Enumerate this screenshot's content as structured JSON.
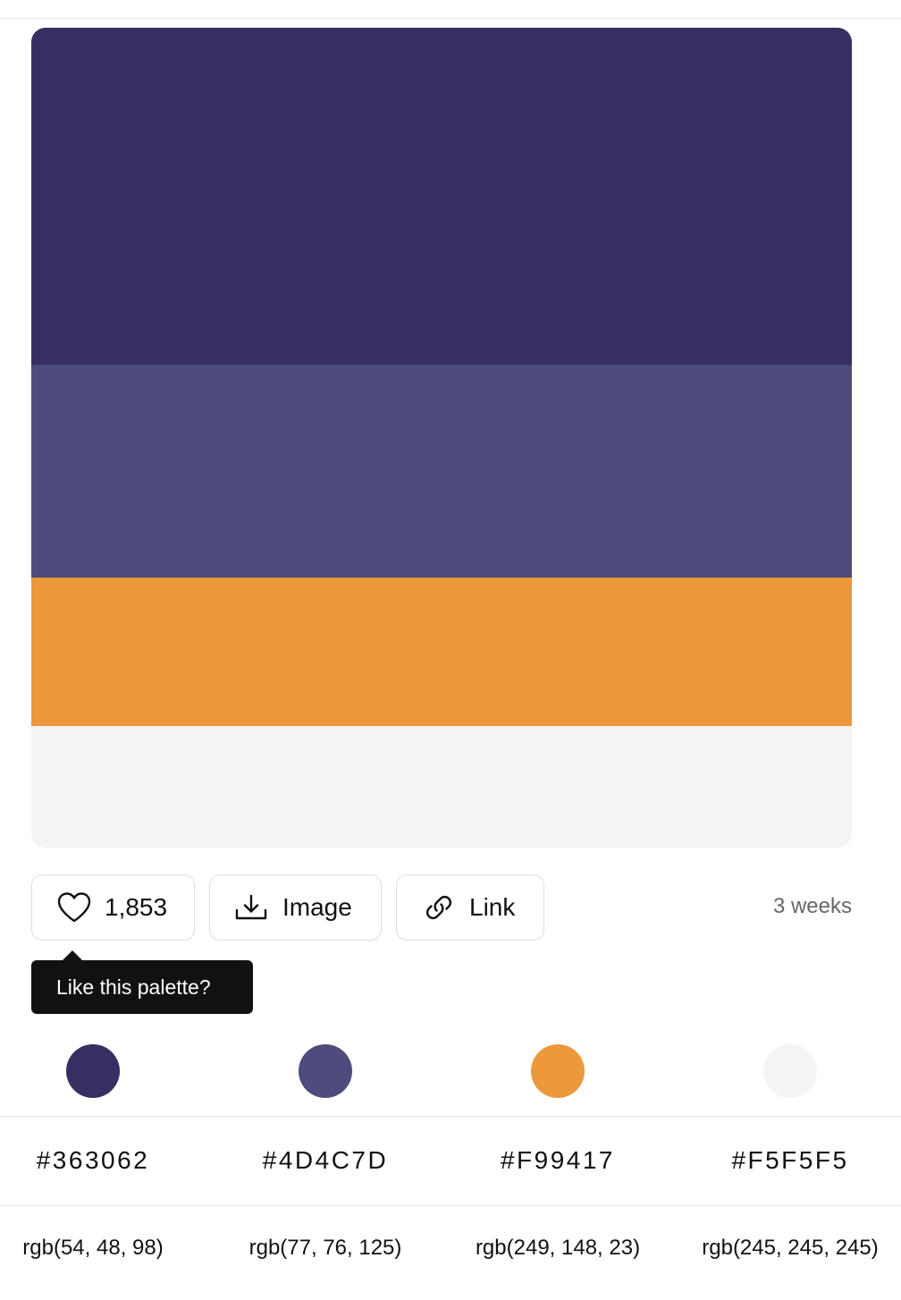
{
  "palette": {
    "colors": [
      {
        "hex": "#363062",
        "rgb": "rgb(54, 48, 98)"
      },
      {
        "hex": "#4D4C7D",
        "rgb": "rgb(77, 76, 125)"
      },
      {
        "hex": "#F99417",
        "rgb": "rgb(249, 148, 23)"
      },
      {
        "hex": "#F5F5F5",
        "rgb": "rgb(245, 245, 245)"
      }
    ]
  },
  "actions": {
    "like_count": "1,853",
    "image_label": "Image",
    "link_label": "Link",
    "time_ago": "3 weeks"
  },
  "tooltip": {
    "text": "Like this palette?"
  },
  "icons": {
    "like": "heart-icon",
    "image": "download-icon",
    "link": "link-icon"
  }
}
